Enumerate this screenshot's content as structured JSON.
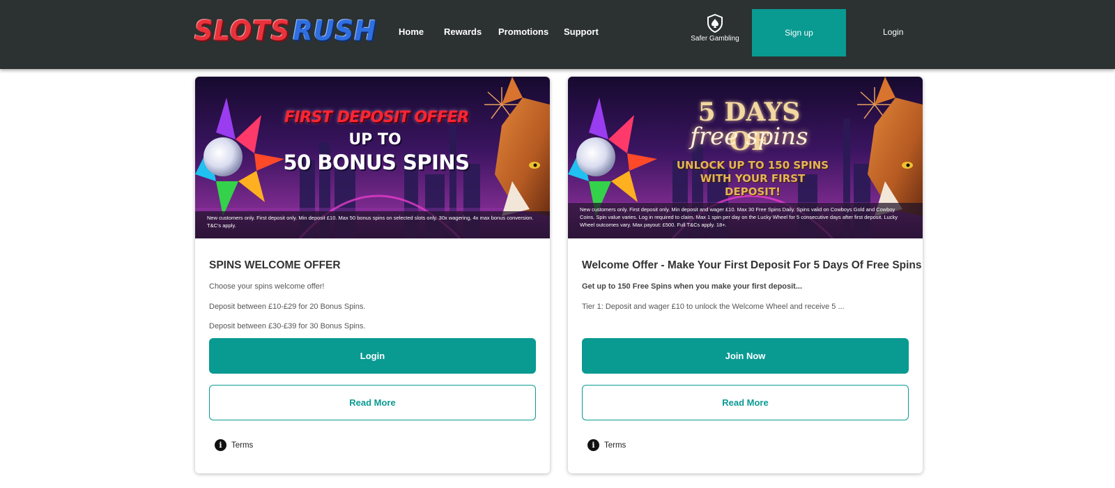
{
  "header": {
    "logo": {
      "part1": "SLOTS",
      "part2": "RUSH"
    },
    "nav": [
      "Home",
      "Rewards",
      "Promotions",
      "Support"
    ],
    "safer_gambling": "Safer Gambling",
    "signup": "Sign up",
    "login": "Login"
  },
  "cards": [
    {
      "banner": {
        "line1": "FIRST DEPOSIT OFFER",
        "line2": "UP TO",
        "line3": "50 BONUS SPINS",
        "terms": "New customers only. First deposit only. Min deposit £10. Max 50 bonus spins on selected slots only. 30x wagering, 4x max bonus conversion. T&C's apply."
      },
      "title": "SPINS WELCOME OFFER",
      "paragraphs": [
        "Choose your spins welcome offer!",
        "Deposit between £10-£29 for 20 Bonus Spins.",
        "Deposit between £30-£39 for 30 Bonus Spins."
      ],
      "primary_button": "Login",
      "secondary_button": "Read More",
      "terms_link": "Terms"
    },
    {
      "banner": {
        "line1": "5 DAYS OF",
        "line2": "free spins",
        "line3": "UNLOCK UP TO 150 SPINS WITH YOUR FIRST DEPOSIT!",
        "terms": "New customers only. First deposit only. Min deposit and wager £10. Max 30 Free Spins Daily. Spins valid on Cowboys Gold and Cowboy Coins. Spin value varies. Log in required to claim. Max 1 spin per day on the Lucky Wheel for 5 consecutive days after first deposit. Lucky Wheel outcomes vary. Max payout: £500. Full T&Cs apply. 18+."
      },
      "title": "Welcome Offer - Make Your First Deposit For 5 Days Of Free Spins",
      "paragraphs": [
        "Get up to 150 Free Spins when you make your first deposit...",
        "Tier 1: Deposit and wager £10 to unlock the Welcome Wheel and receive 5 ..."
      ],
      "primary_button": "Join Now",
      "secondary_button": "Read More",
      "terms_link": "Terms"
    }
  ],
  "colors": {
    "header_bg": "#2b3231",
    "accent": "#099a92"
  }
}
